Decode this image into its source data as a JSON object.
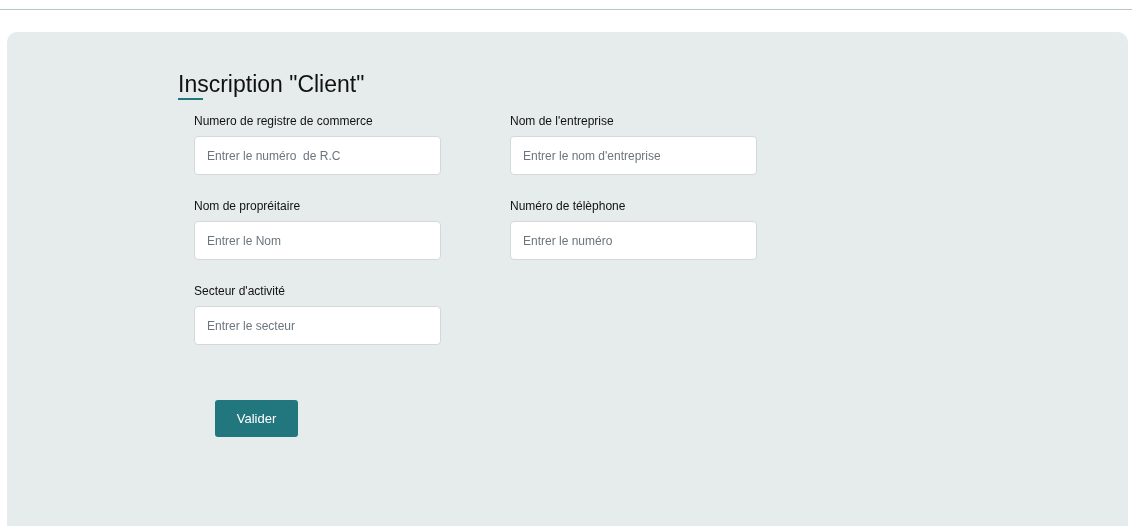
{
  "form": {
    "title": "Inscription \"Client\"",
    "fields": [
      {
        "label": "Numero de registre de commerce",
        "placeholder": "Entrer le numéro  de R.C"
      },
      {
        "label": "Nom de l'entreprise",
        "placeholder": "Entrer le nom d'entreprise"
      },
      {
        "label": "Nom de propréitaire",
        "placeholder": "Entrer le Nom"
      },
      {
        "label": "Numéro de télèphone",
        "placeholder": "Entrer le numéro"
      },
      {
        "label": "Secteur d'activité",
        "placeholder": "Entrer le secteur"
      }
    ],
    "submit": "Valider"
  }
}
